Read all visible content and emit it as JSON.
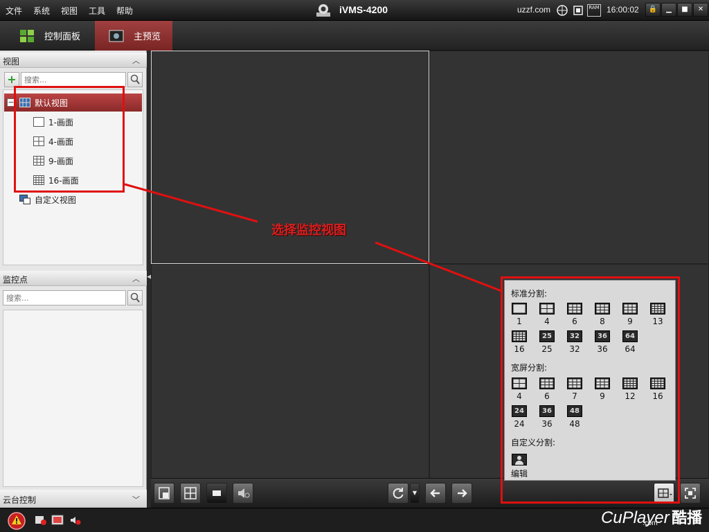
{
  "menu": [
    "文件",
    "系统",
    "视图",
    "工具",
    "帮助"
  ],
  "app_title": "iVMS-4200",
  "site": "uzzf.com",
  "clock": "16:00:02",
  "ram_label": "RAM",
  "tabs": [
    {
      "label": "控制面板"
    },
    {
      "label": "主预览"
    }
  ],
  "views": {
    "header": "视图",
    "search_placeholder": "搜索...",
    "root": "默认视图",
    "items": [
      "1-画面",
      "4-画面",
      "9-画面",
      "16-画面"
    ],
    "custom": "自定义视图"
  },
  "monitor": {
    "header": "监控点",
    "search_placeholder": "搜索..."
  },
  "ptz": {
    "header": "云台控制"
  },
  "annotation": "选择监控视图",
  "popup": {
    "standard_title": "标准分割:",
    "standard": [
      "1",
      "4",
      "6",
      "8",
      "9",
      "13",
      "16",
      "25",
      "32",
      "36",
      "64"
    ],
    "wide_title": "宽屏分割:",
    "wide": [
      "4",
      "6",
      "7",
      "9",
      "12",
      "16",
      "24",
      "36",
      "48"
    ],
    "custom_title": "自定义分割:",
    "edit_label": "编辑"
  },
  "watermark": {
    "brand": "CuPlayer",
    "cn": "酷播",
    "sub": ".com"
  },
  "colors": {
    "accent": "#8a2a2a",
    "annotation": "#e01010"
  }
}
